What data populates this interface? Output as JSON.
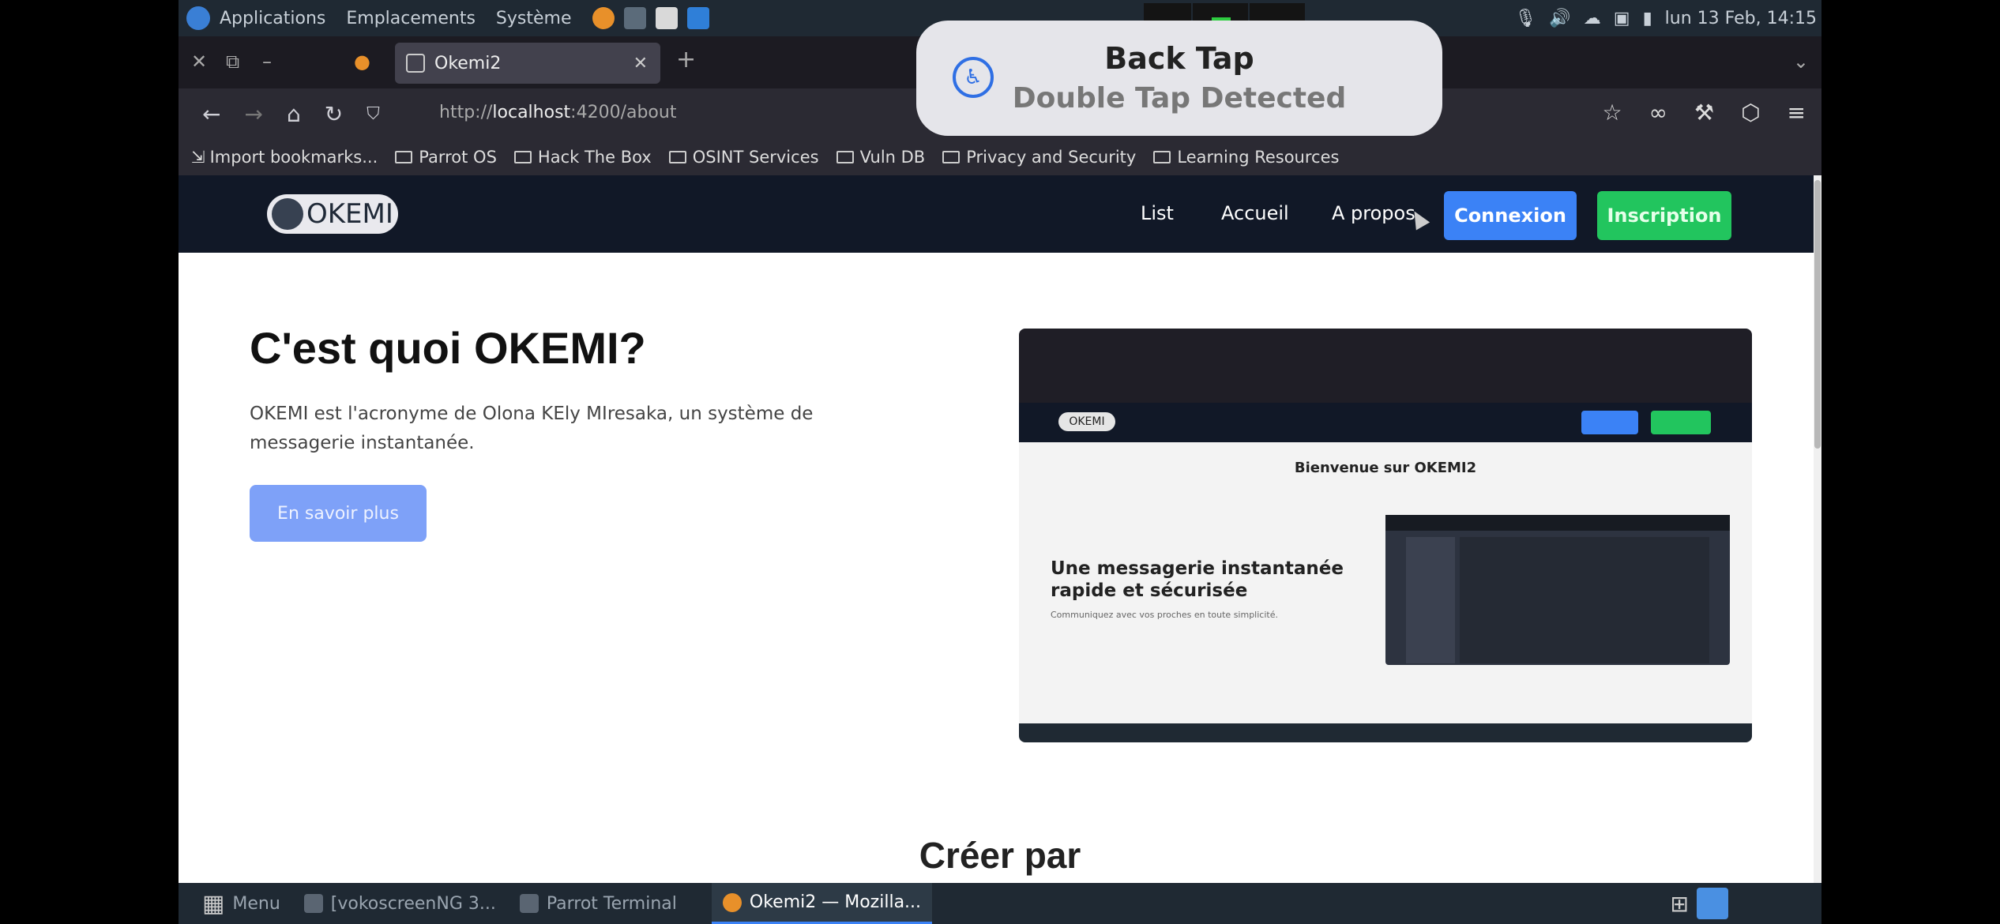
{
  "system_bar": {
    "applications": "Applications",
    "places": "Emplacements",
    "system": "Système",
    "clock": "lun 13 Feb, 14:15"
  },
  "browser": {
    "tab_title": "Okemi2",
    "url_prefix": "http://",
    "url_host": "localhost",
    "url_path": ":4200/about",
    "bookmarks": [
      "Import bookmarks...",
      "Parrot OS",
      "Hack The Box",
      "OSINT Services",
      "Vuln DB",
      "Privacy and Security",
      "Learning Resources"
    ]
  },
  "site": {
    "logo_text": "OKEMI",
    "nav": [
      "List",
      "Accueil",
      "A propos"
    ],
    "login_label": "Connexion",
    "signup_label": "Inscription",
    "hero_title": "C'est quoi OKEMI?",
    "hero_description": "OKEMI est l'acronyme de Olona KEly MIresaka, un système de messagerie instantanée.",
    "more_label": "En savoir plus",
    "section_title": "Créer par",
    "preview": {
      "logo": "OKEMI",
      "welcome": "Bienvenue sur OKEMI2",
      "headline": "Une messagerie instantanée rapide et sécurisée",
      "subtext": "Communiquez avec vos proches en toute simplicité."
    }
  },
  "taskbar": {
    "menu": "Menu",
    "tasks": [
      "[vokoscreenNG 3...",
      "Parrot Terminal",
      "Okemi2 — Mozilla..."
    ]
  },
  "overlay": {
    "title": "Back Tap",
    "subtitle": "Double Tap Detected"
  }
}
